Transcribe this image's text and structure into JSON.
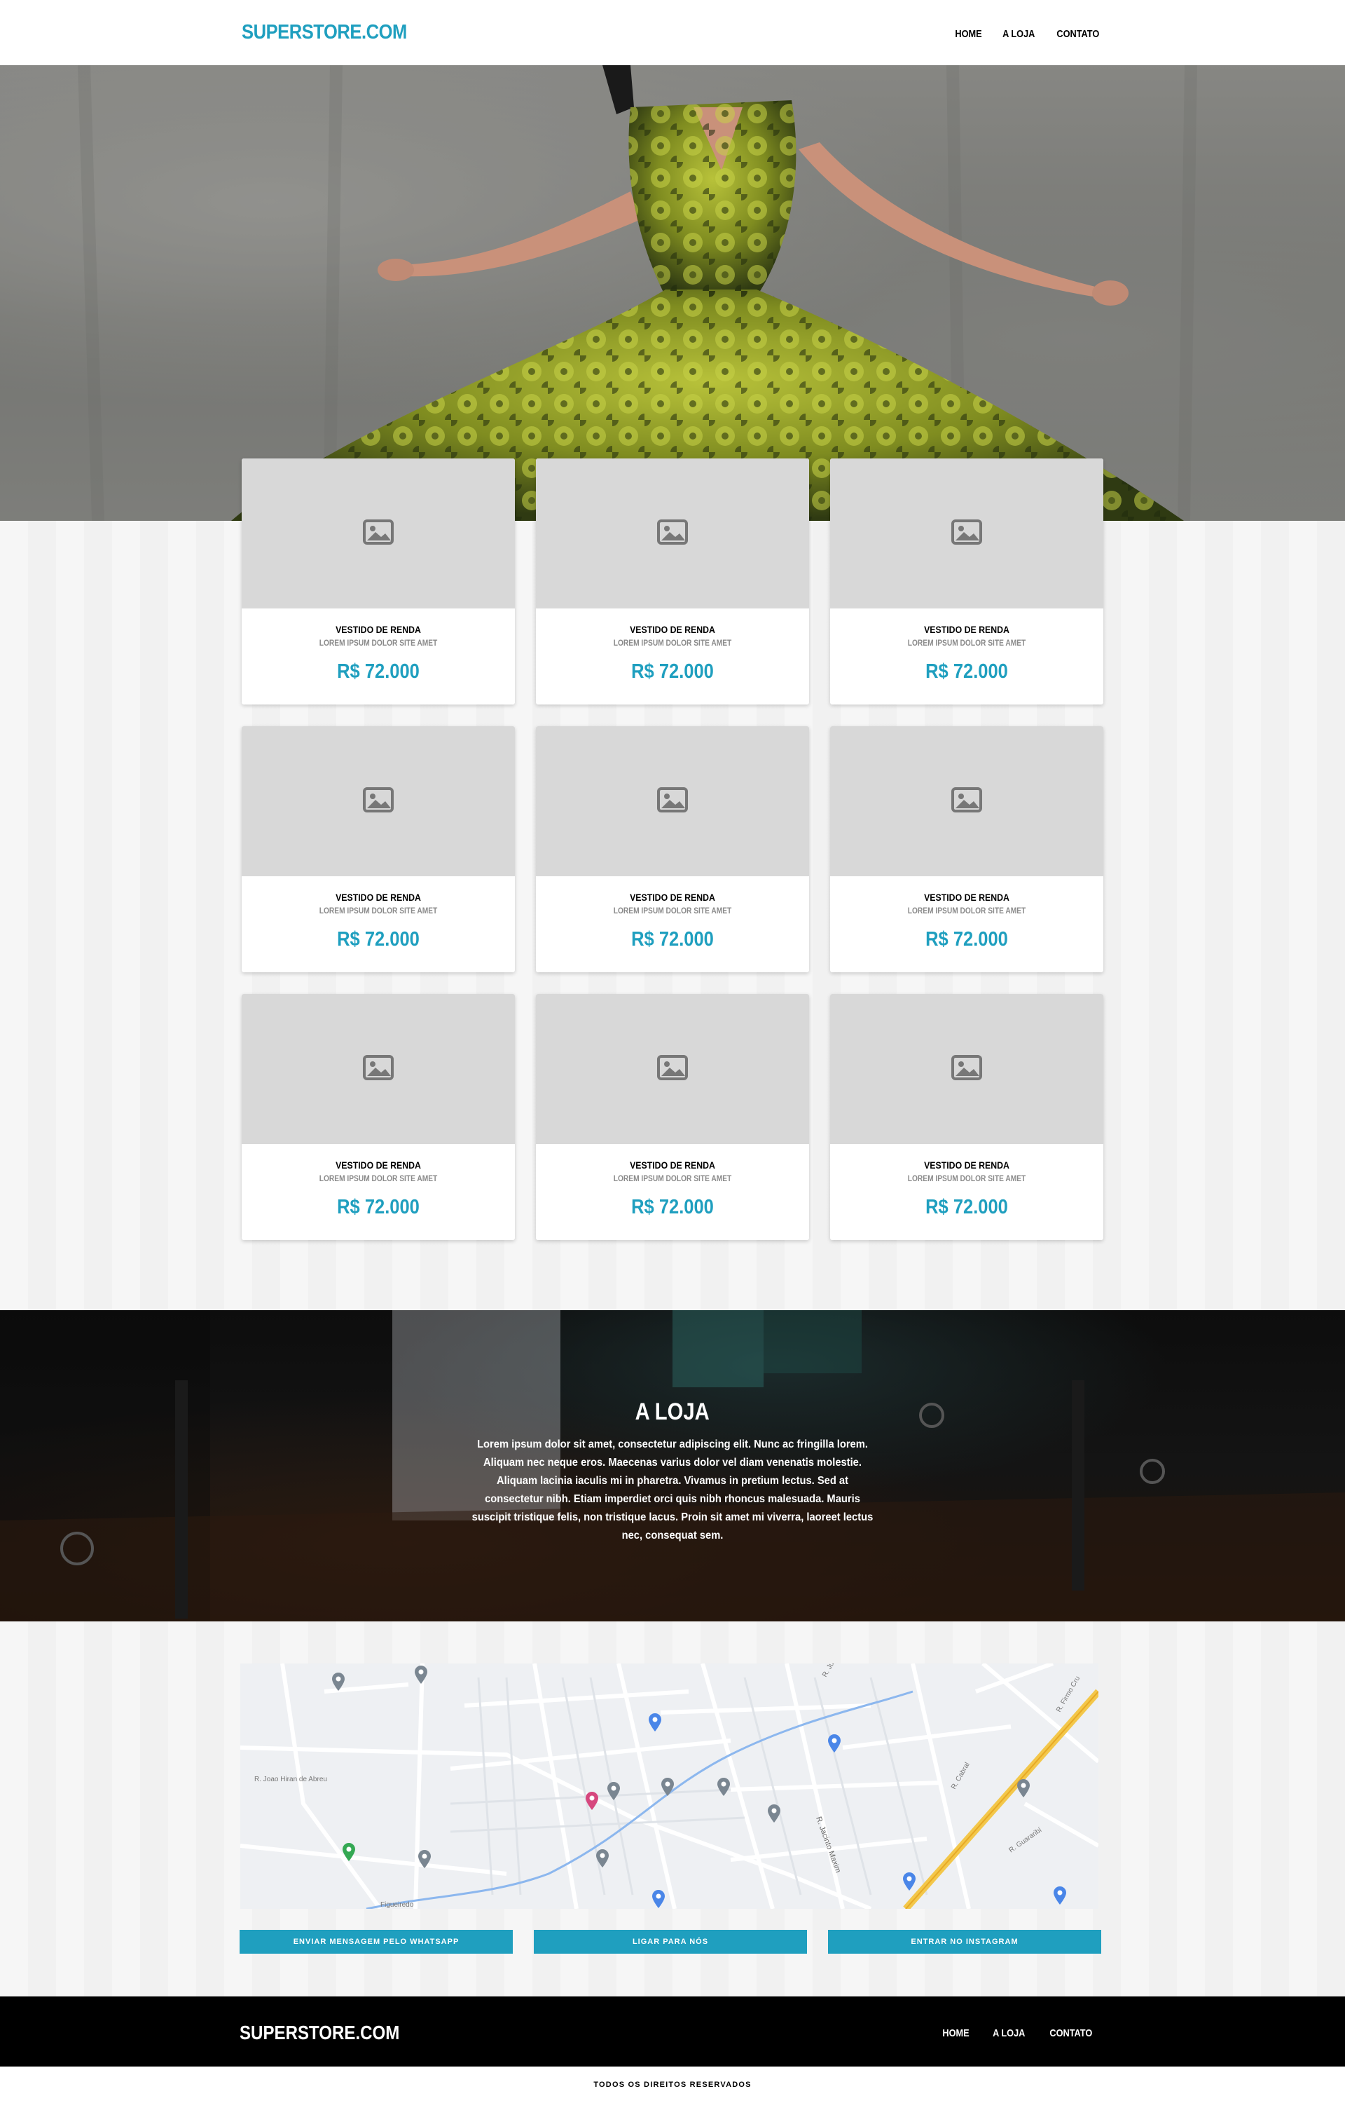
{
  "header": {
    "brand": "SUPERSTORE.COM",
    "nav": [
      "HOME",
      "A LOJA",
      "CONTATO"
    ]
  },
  "products": [
    {
      "title": "VESTIDO DE RENDA",
      "subtitle": "LOREM IPSUM DOLOR SITE AMET",
      "price": "R$ 72.000"
    },
    {
      "title": "VESTIDO DE RENDA",
      "subtitle": "LOREM IPSUM DOLOR SITE AMET",
      "price": "R$ 72.000"
    },
    {
      "title": "VESTIDO DE RENDA",
      "subtitle": "LOREM IPSUM DOLOR SITE AMET",
      "price": "R$ 72.000"
    },
    {
      "title": "VESTIDO DE RENDA",
      "subtitle": "LOREM IPSUM DOLOR SITE AMET",
      "price": "R$ 72.000"
    },
    {
      "title": "VESTIDO DE RENDA",
      "subtitle": "LOREM IPSUM DOLOR SITE AMET",
      "price": "R$ 72.000"
    },
    {
      "title": "VESTIDO DE RENDA",
      "subtitle": "LOREM IPSUM DOLOR SITE AMET",
      "price": "R$ 72.000"
    },
    {
      "title": "VESTIDO DE RENDA",
      "subtitle": "LOREM IPSUM DOLOR SITE AMET",
      "price": "R$ 72.000"
    },
    {
      "title": "VESTIDO DE RENDA",
      "subtitle": "LOREM IPSUM DOLOR SITE AMET",
      "price": "R$ 72.000"
    },
    {
      "title": "VESTIDO DE RENDA",
      "subtitle": "LOREM IPSUM DOLOR SITE AMET",
      "price": "R$ 72.000"
    }
  ],
  "about": {
    "title": "A LOJA",
    "text": "Lorem ipsum dolor sit amet, consectetur adipiscing elit. Nunc ac fringilla lorem. Aliquam nec neque eros. Maecenas varius dolor vel diam venenatis molestie. Aliquam lacinia iaculis mi in pharetra. Vivamus in pretium lectus. Sed at consectetur nibh. Etiam imperdiet orci quis nibh rhoncus malesuada. Mauris suscipit tristique felis, non tristique lacus. Proin sit amet mi viverra, laoreet lectus nec, consequat sem."
  },
  "map": {
    "streets": [
      "R. Joao Hiran de Abreu",
      "R. Julia Budã",
      "R. Jacinto Maxim",
      "R. Cabral",
      "R. Guararibí",
      "R. Firmo Cru",
      "Figueiredo"
    ]
  },
  "contact_buttons": [
    "ENVIAR MENSAGEM PELO WHATSAPP",
    "LIGAR PARA NÓS",
    "ENTRAR NO INSTAGRAM"
  ],
  "footer": {
    "brand": "SUPERSTORE.COM",
    "nav": [
      "HOME",
      "A LOJA",
      "CONTATO"
    ],
    "copyright": "TODOS OS DIREITOS RESERVADOS"
  },
  "colors": {
    "accent": "#1f9fbf",
    "footer_bg": "#000000",
    "placeholder": "#d8d8d8"
  },
  "icons": [
    "image-placeholder-icon",
    "map-pin-icon"
  ]
}
